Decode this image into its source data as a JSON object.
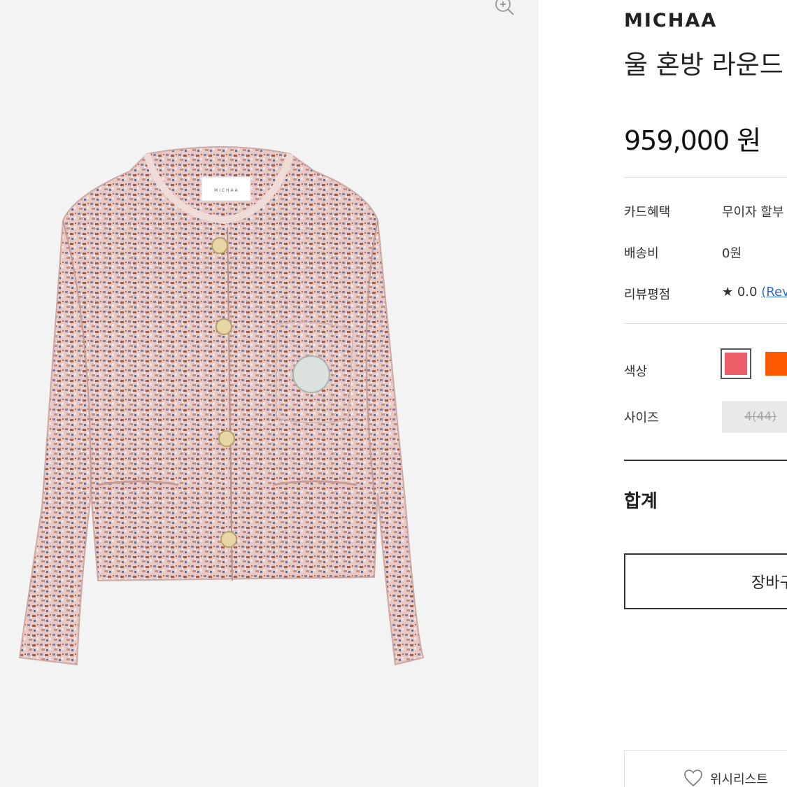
{
  "gallery": {
    "zoom_icon": "zoom-in-icon",
    "image_alt": "tweed-jacket-product-image",
    "label_text": "M I C H A A"
  },
  "product": {
    "brand": "MICHAA",
    "title": "울 혼방 라운드",
    "price": "959,000 원"
  },
  "details": [
    {
      "label": "카드혜택",
      "value": "무이자 할부"
    },
    {
      "label": "배송비",
      "value": "0원"
    },
    {
      "label": "리뷰평점",
      "value": "★ 0.0",
      "link": "(Rev"
    }
  ],
  "options": {
    "color_label": "색상",
    "colors": [
      {
        "name": "pink",
        "hex": "#ec5f69",
        "selected": true
      },
      {
        "name": "orange",
        "hex": "#ff5a00",
        "selected": false
      }
    ],
    "size_label": "사이즈",
    "sizes": [
      {
        "label": "4(44)",
        "available": false
      }
    ]
  },
  "total": {
    "label": "합계"
  },
  "actions": {
    "cart_label": "장바구",
    "wishlist_label": "위시리스트",
    "wishlist_icon": "heart-icon"
  }
}
